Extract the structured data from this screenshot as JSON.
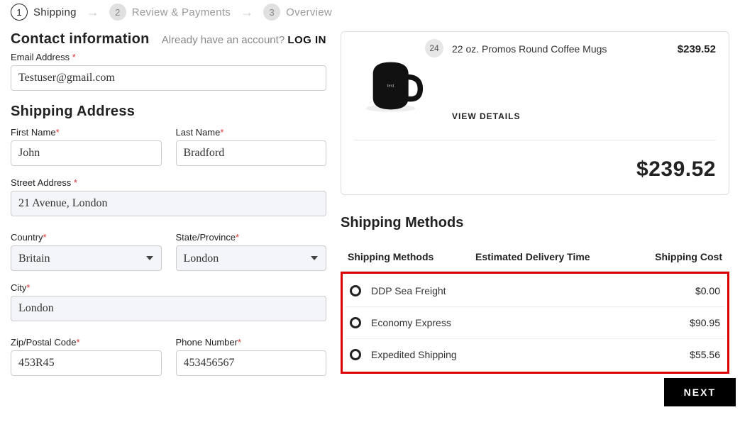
{
  "stepper": {
    "steps": [
      {
        "num": "1",
        "label": "Shipping",
        "active": true
      },
      {
        "num": "2",
        "label": "Review & Payments",
        "active": false
      },
      {
        "num": "3",
        "label": "Overview",
        "active": false
      }
    ]
  },
  "contact": {
    "heading": "Contact information",
    "already_text": "Already have an account? ",
    "login_label": "LOG IN",
    "email_label": "Email Address",
    "email_value": "Testuser@gmail.com"
  },
  "shipping_address": {
    "heading": "Shipping Address",
    "first_name_label": "First Name",
    "first_name_value": "John",
    "last_name_label": "Last Name",
    "last_name_value": "Bradford",
    "street_label": "Street Address",
    "street_value": "21 Avenue, London",
    "country_label": "Country",
    "country_value": "Britain",
    "state_label": "State/Province",
    "state_value": "London",
    "city_label": "City",
    "city_value": "London",
    "zip_label": "Zip/Postal Code",
    "zip_value": "453R45",
    "phone_label": "Phone Number",
    "phone_value": "453456567"
  },
  "summary": {
    "item_qty": "24",
    "item_name": "22 oz. Promos Round Coffee Mugs",
    "item_price": "$239.52",
    "view_details": "VIEW DETAILS",
    "grand_total": "$239.52"
  },
  "shipping_methods": {
    "heading": "Shipping Methods",
    "col_method": "Shipping Methods",
    "col_eta": "Estimated Delivery Time",
    "col_cost": "Shipping Cost",
    "options": [
      {
        "name": "DDP Sea Freight",
        "cost": "$0.00"
      },
      {
        "name": "Economy Express",
        "cost": "$90.95"
      },
      {
        "name": "Expedited Shipping",
        "cost": "$55.56"
      }
    ]
  },
  "next_label": "NEXT"
}
